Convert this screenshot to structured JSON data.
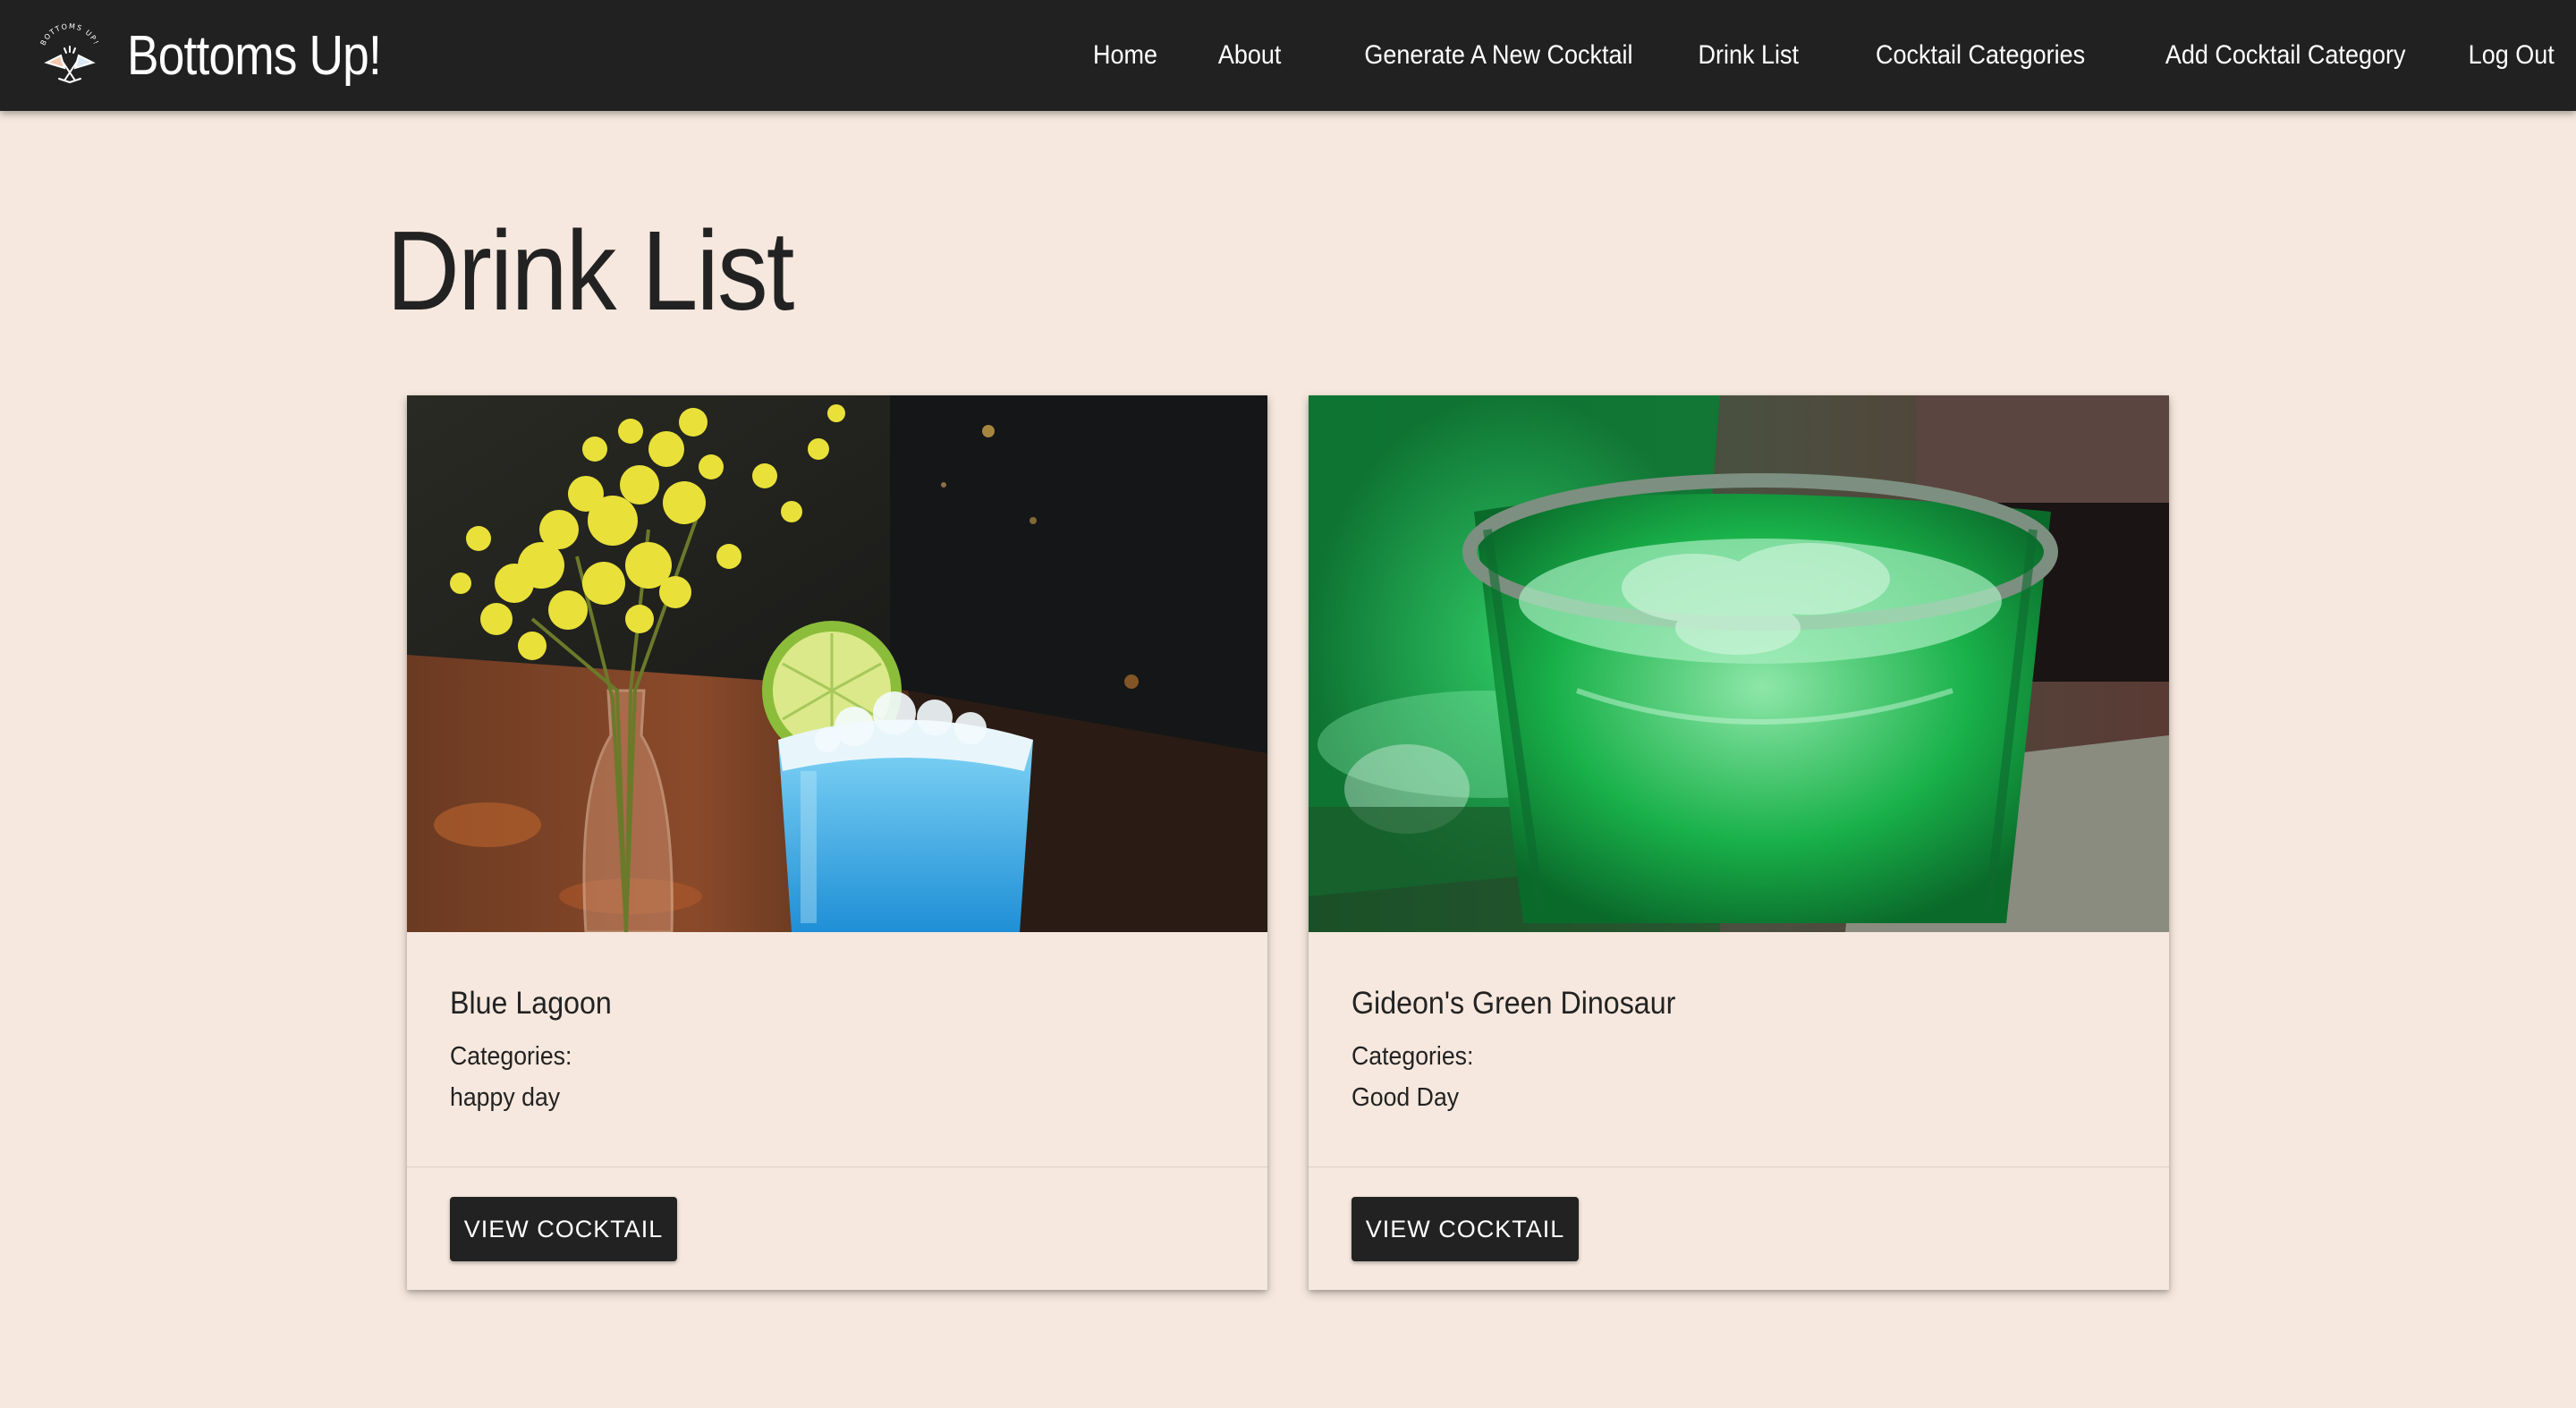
{
  "navbar": {
    "brand_title": "Bottoms Up!",
    "logo_text": "BOTTOMS UP!",
    "links": [
      "Home",
      "About",
      "Generate A New Cocktail",
      "Drink List",
      "Cocktail Categories",
      "Add Cocktail Category",
      "Log Out"
    ]
  },
  "page": {
    "title": "Drink List"
  },
  "cards": [
    {
      "name": "Blue Lagoon",
      "categories_label": "Categories:",
      "categories": [
        "happy day"
      ],
      "button_label": "VIEW COCKTAIL"
    },
    {
      "name": "Gideon's Green Dinosaur",
      "categories_label": "Categories:",
      "categories": [
        "Good Day"
      ],
      "button_label": "VIEW COCKTAIL"
    }
  ],
  "colors": {
    "navbar_bg": "#212121",
    "page_bg": "#f6e8de",
    "button_bg": "#222222"
  }
}
